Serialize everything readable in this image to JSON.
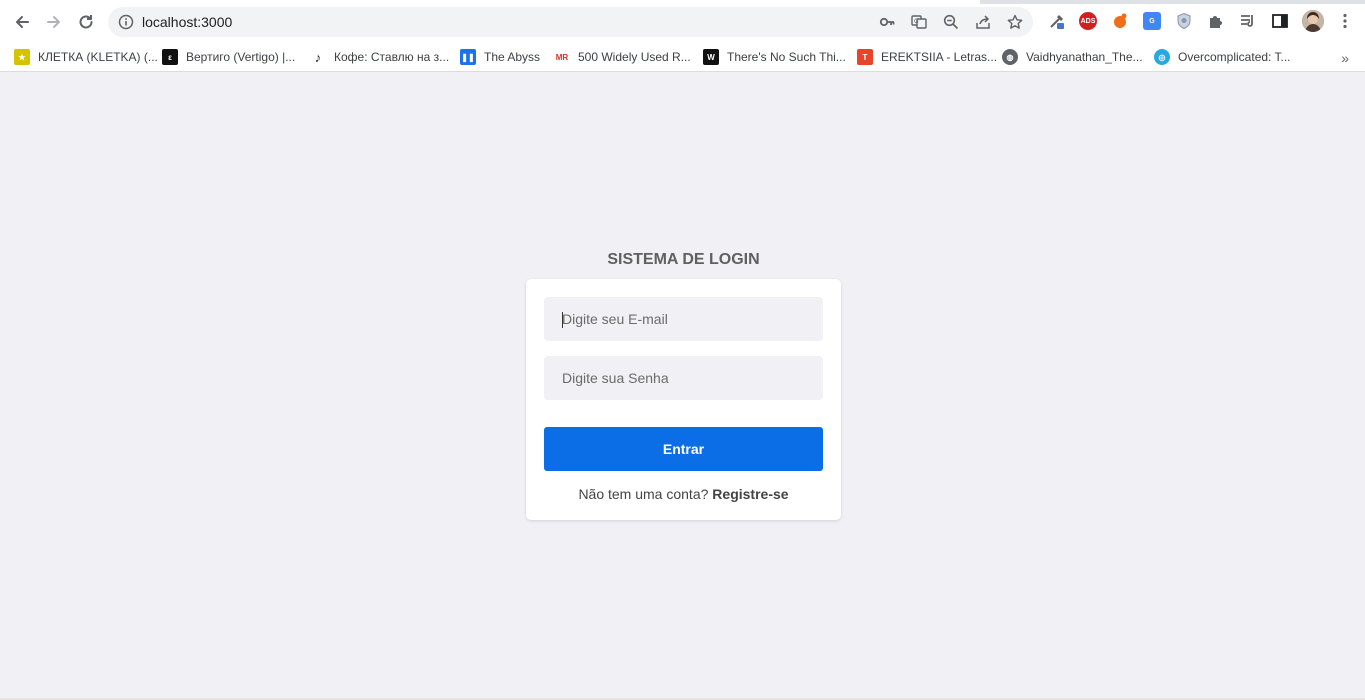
{
  "browser": {
    "url": "localhost:3000",
    "nav": {
      "back_icon": "arrow-left-icon",
      "forward_icon": "arrow-right-icon",
      "reload_icon": "reload-icon"
    },
    "omnibox_icons": [
      "key-icon",
      "translate-icon",
      "zoom-out-icon",
      "share-icon",
      "star-icon"
    ],
    "extensions": [
      {
        "name": "eyedropper-extension-icon",
        "color": "#4a76c7",
        "text": ""
      },
      {
        "name": "adblock-extension-icon",
        "color": "#d21f1f",
        "text": "ADS"
      },
      {
        "name": "hand-extension-icon",
        "color": "#f06d1a",
        "text": ""
      },
      {
        "name": "google-translate-extension-icon",
        "color": "#4285f4",
        "text": "G"
      },
      {
        "name": "shield-extension-icon",
        "color": "#9aa7b8",
        "text": ""
      },
      {
        "name": "puzzle-extensions-icon",
        "color": "#5f6368",
        "text": ""
      },
      {
        "name": "reading-list-icon",
        "color": "#5f6368",
        "text": ""
      },
      {
        "name": "side-panel-icon",
        "color": "#5f6368",
        "text": ""
      }
    ],
    "profile_avatar": "profile-avatar",
    "menu_icon": "kebab-menu-icon"
  },
  "bookmarks": [
    {
      "label": "КЛЕТКА (KLETKA) (...",
      "icon": "yellow-star-favicon",
      "color": "#d4c400"
    },
    {
      "label": "Вертиго (Vertigo) |...",
      "icon": "vertigo-favicon",
      "color": "#111111"
    },
    {
      "label": "Кофе: Ставлю на з...",
      "icon": "music-note-favicon",
      "color": "#222222"
    },
    {
      "label": "The Abyss",
      "icon": "pause-favicon",
      "color": "#1a73e8"
    },
    {
      "label": "500 Widely Used R...",
      "icon": "mr-favicon",
      "color": "#d93025"
    },
    {
      "label": "There's No Such Thi...",
      "icon": "dark-favicon",
      "color": "#111111"
    },
    {
      "label": "EREKTSIIA - Letras...",
      "icon": "t-favicon",
      "color": "#e8442b"
    },
    {
      "label": "Vaidhyanathan_The...",
      "icon": "globe-favicon",
      "color": "#5f6368"
    },
    {
      "label": "Overcomplicated: T...",
      "icon": "circle-favicon",
      "color": "#2aa7e0"
    }
  ],
  "bookmarks_more": "»",
  "login": {
    "title": "SISTEMA DE LOGIN",
    "email_placeholder": "Digite seu E-mail",
    "password_placeholder": "Digite sua Senha",
    "submit_label": "Entrar",
    "signup_prompt": "Não tem uma conta?",
    "signup_link": "Registre-se"
  },
  "colors": {
    "page_background": "#f0f0f5",
    "button": "#0b6ee6"
  }
}
